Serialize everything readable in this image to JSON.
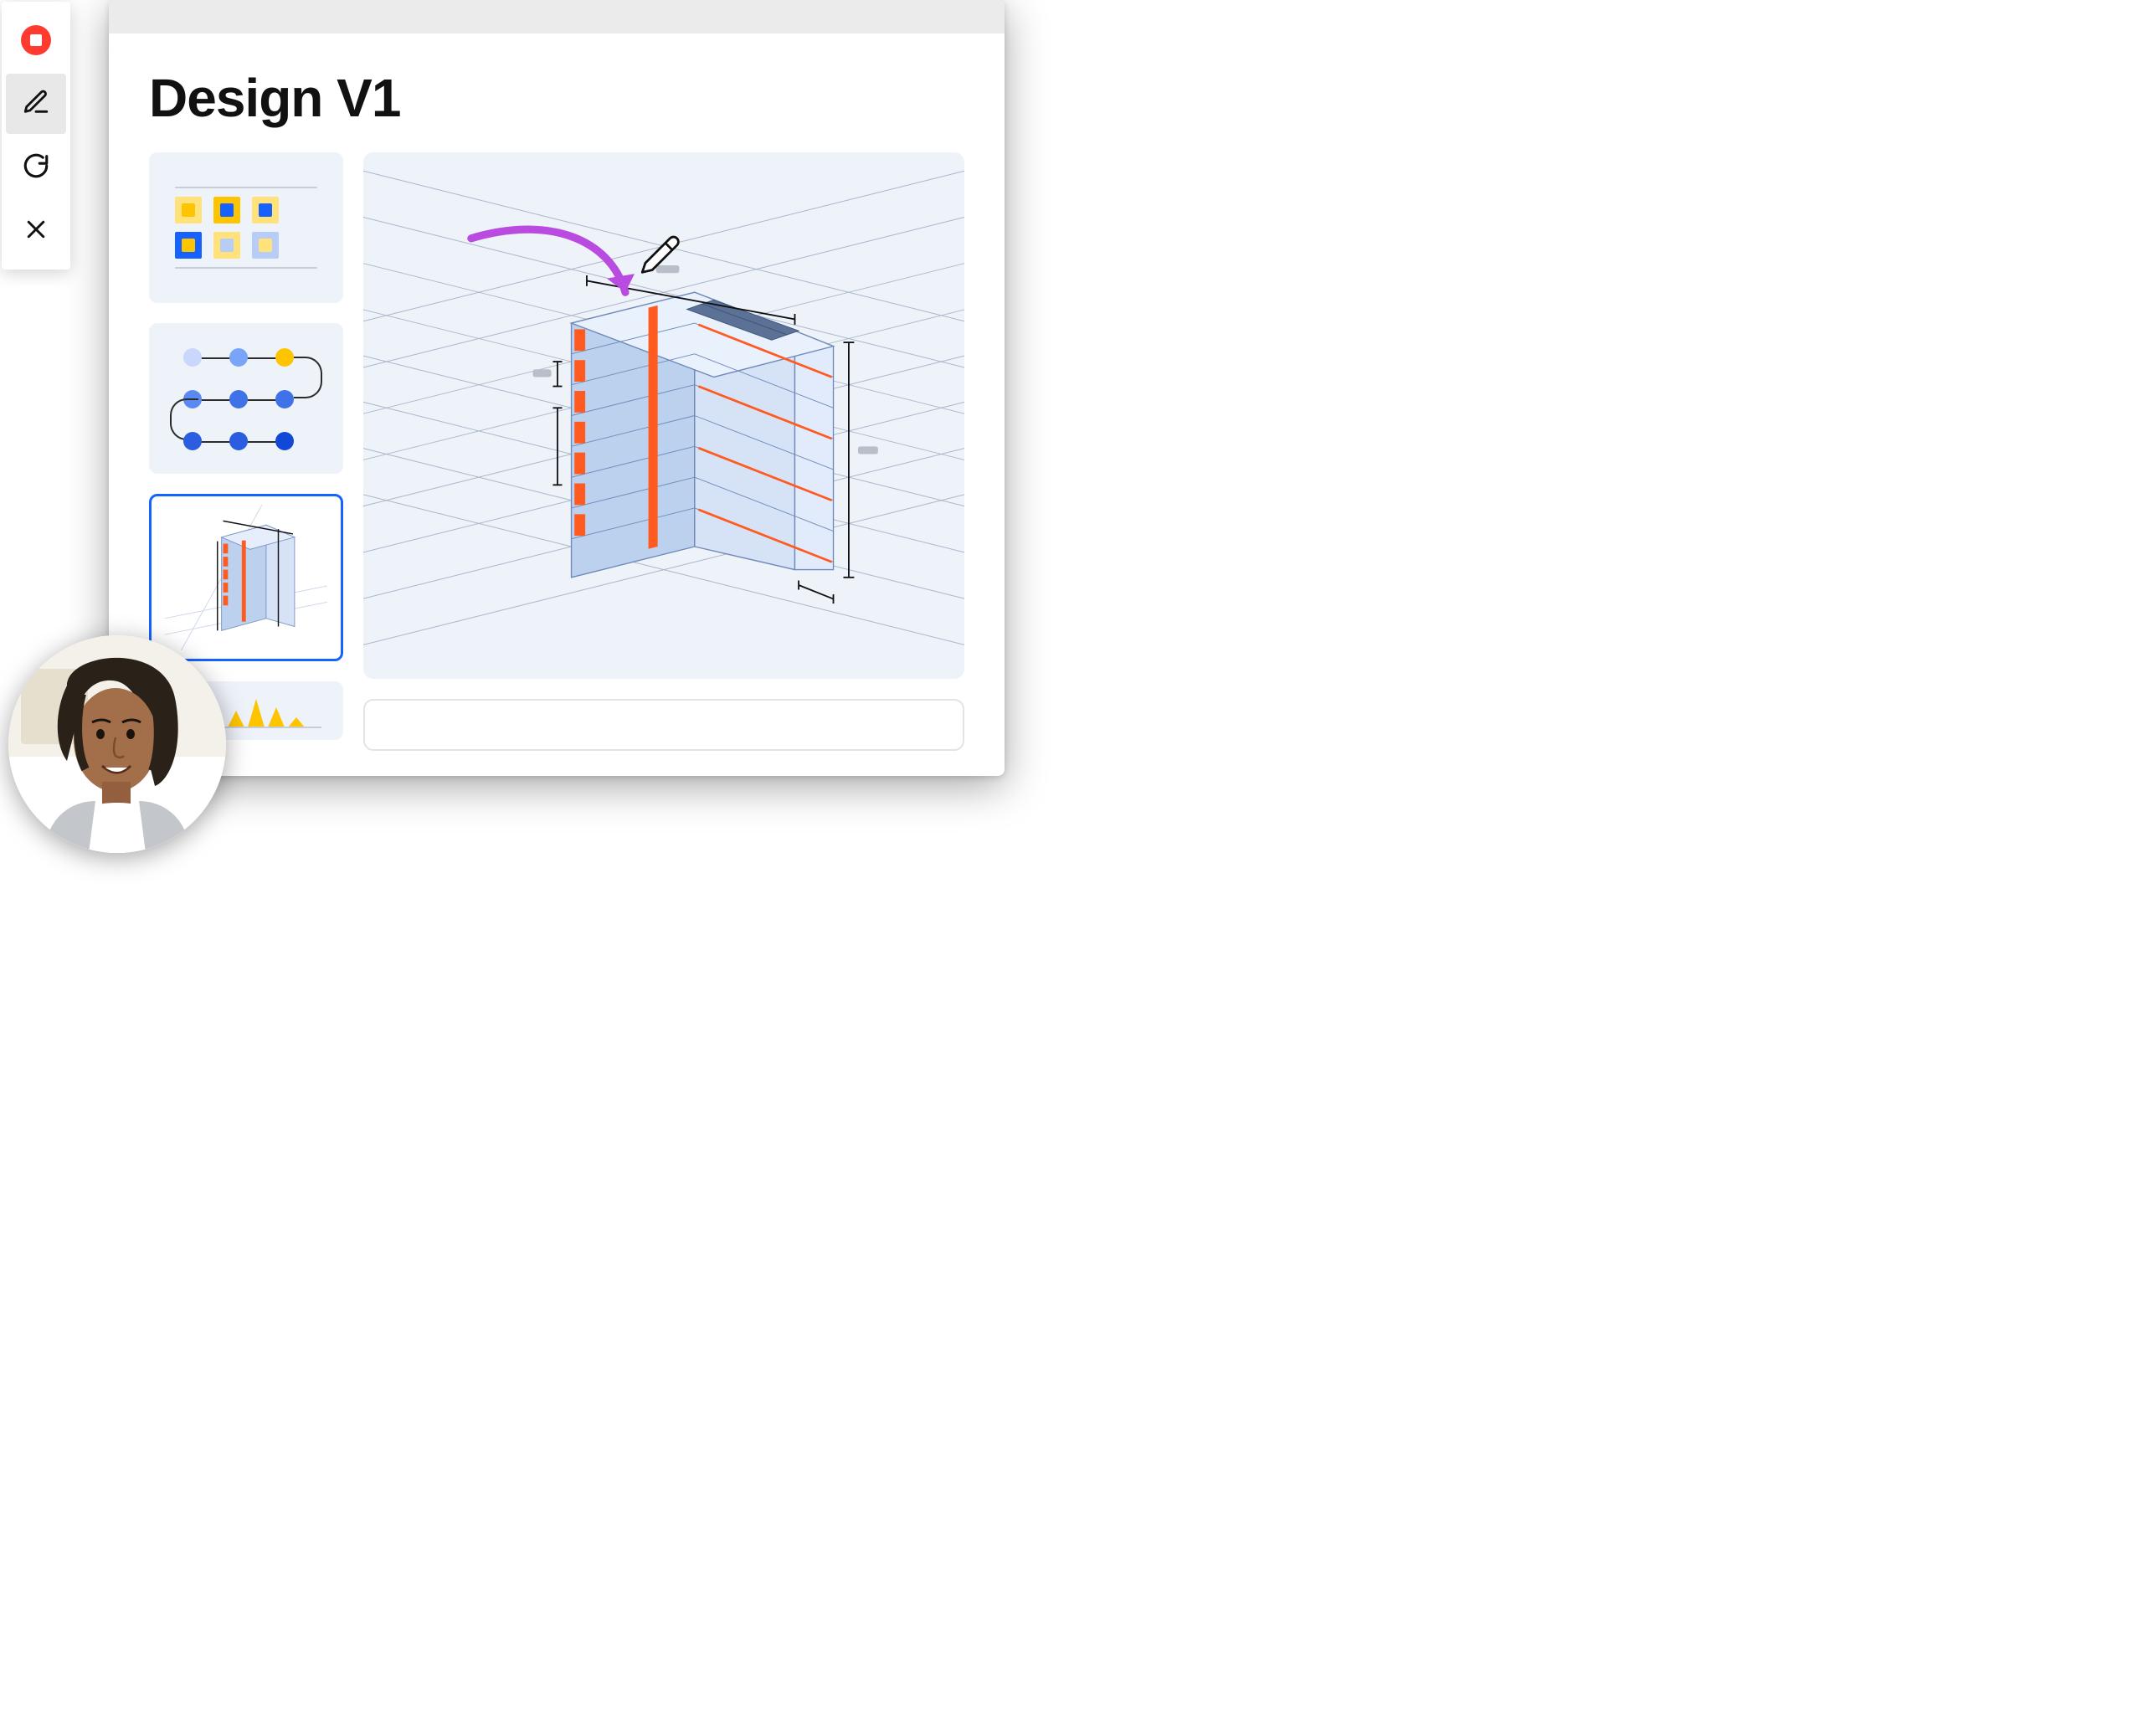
{
  "toolbar": {
    "items": [
      {
        "name": "record-stop-button",
        "icon": "record-stop-icon"
      },
      {
        "name": "edit-button",
        "icon": "pencil-icon",
        "active": true
      },
      {
        "name": "redo-button",
        "icon": "redo-icon"
      },
      {
        "name": "close-button",
        "icon": "close-icon"
      }
    ]
  },
  "page": {
    "title": "Design V1"
  },
  "thumbnails": {
    "items": [
      {
        "name": "thumb-color-swatches",
        "kind": "swatches",
        "selected": false
      },
      {
        "name": "thumb-flow-nodes",
        "kind": "nodes",
        "selected": false
      },
      {
        "name": "thumb-building-3d",
        "kind": "building",
        "selected": true
      },
      {
        "name": "thumb-bar-chart",
        "kind": "chart",
        "selected": false
      }
    ],
    "swatch_colors": {
      "row1": [
        {
          "outer": "#ffe37a",
          "inner": "#ffc400"
        },
        {
          "outer": "#ffc400",
          "inner": "#1662ff"
        },
        {
          "outer": "#ffe37a",
          "inner": "#1662ff"
        }
      ],
      "row2": [
        {
          "outer": "#1662ff",
          "inner": "#ffc400"
        },
        {
          "outer": "#ffe37a",
          "inner": "#b7cdf7"
        },
        {
          "outer": "#b7cdf7",
          "inner": "#ffe37a"
        }
      ]
    },
    "node_colors": [
      "#c8d7fb",
      "#7aa4f7",
      "#ffc400",
      "#5a89f2",
      "#3f72e8",
      "#3f72e8",
      "#2a5de0",
      "#2a5de0",
      "#1148d8"
    ]
  },
  "canvas": {
    "kind": "3d-building-isometric",
    "annotation_arrow_color": "#b94be0",
    "building_accent_color": "#ff5a1f",
    "building_body_color": "#bcd1ee",
    "pencil_icon": "pencil-icon"
  },
  "caption": {
    "text": ""
  },
  "avatar": {
    "alt": "presenter-avatar"
  }
}
